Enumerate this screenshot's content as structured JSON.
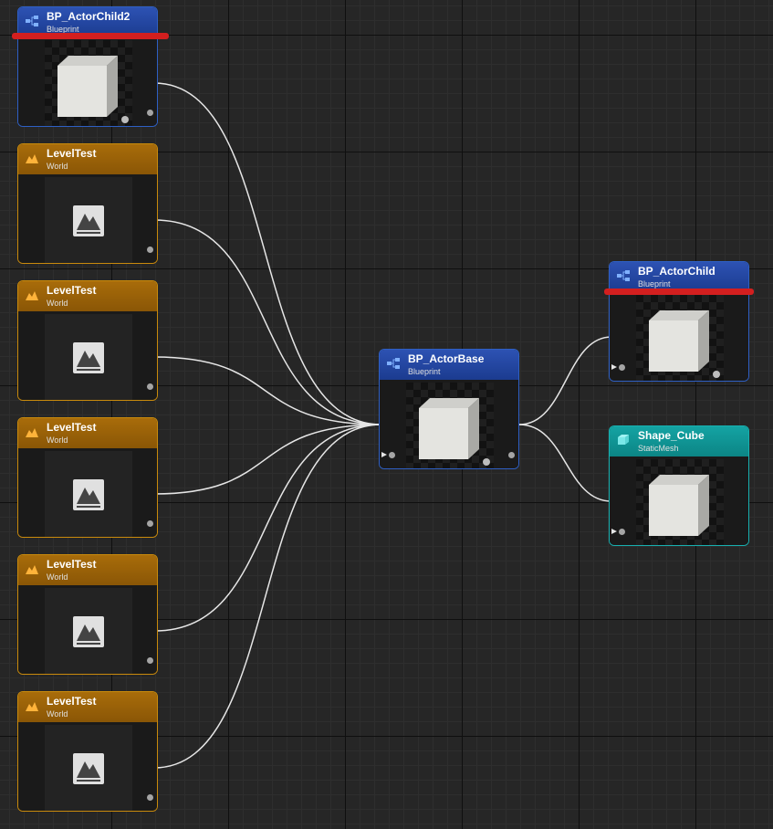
{
  "graph": {
    "nodes": {
      "bp_actor_child2": {
        "title": "BP_ActorChild2",
        "subtitle": "Blueprint"
      },
      "level_test_1": {
        "title": "LevelTest",
        "subtitle": "World"
      },
      "level_test_2": {
        "title": "LevelTest",
        "subtitle": "World"
      },
      "level_test_3": {
        "title": "LevelTest",
        "subtitle": "World"
      },
      "level_test_4": {
        "title": "LevelTest",
        "subtitle": "World"
      },
      "level_test_5": {
        "title": "LevelTest",
        "subtitle": "World"
      },
      "bp_actor_base": {
        "title": "BP_ActorBase",
        "subtitle": "Blueprint"
      },
      "bp_actor_child": {
        "title": "BP_ActorChild",
        "subtitle": "Blueprint"
      },
      "shape_cube": {
        "title": "Shape_Cube",
        "subtitle": "StaticMesh"
      }
    },
    "highlighted": [
      "bp_actor_child2",
      "bp_actor_child"
    ]
  },
  "colors": {
    "blueprint_header": "#1f44a0",
    "world_header": "#9a6008",
    "static_mesh_header": "#0f9999",
    "highlight_bar": "#d31f1f",
    "wire": "#e6e6e6"
  }
}
